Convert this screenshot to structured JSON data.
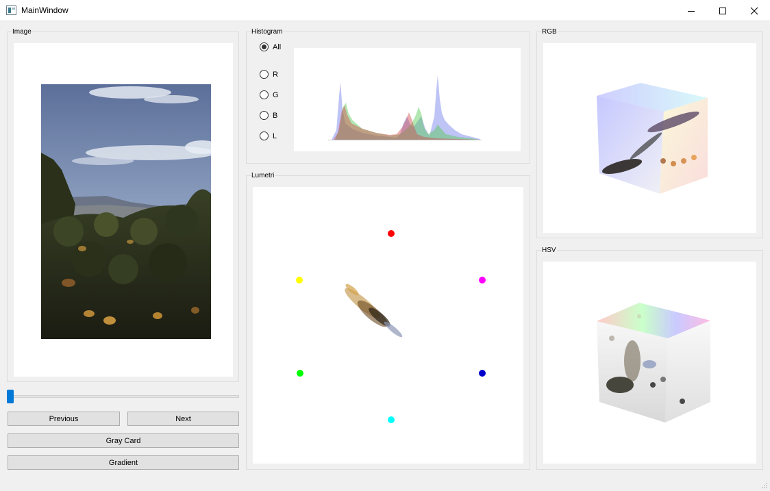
{
  "window": {
    "title": "MainWindow"
  },
  "groups": {
    "image": "Image",
    "histogram": "Histogram",
    "lumetri": "Lumetri",
    "rgb": "RGB",
    "hsv": "HSV"
  },
  "histogram": {
    "channels": [
      {
        "label": "All",
        "checked": true
      },
      {
        "label": "R",
        "checked": false
      },
      {
        "label": "G",
        "checked": false
      },
      {
        "label": "B",
        "checked": false
      },
      {
        "label": "L",
        "checked": false
      }
    ]
  },
  "slider": {
    "value_fraction": 0.0
  },
  "buttons": {
    "previous": "Previous",
    "next": "Next",
    "gray_card": "Gray Card",
    "gradient": "Gradient"
  },
  "lumetri": {
    "targets": [
      {
        "name": "red",
        "color": "#ff0000"
      },
      {
        "name": "magenta",
        "color": "#ff00ff"
      },
      {
        "name": "blue",
        "color": "#0000ff"
      },
      {
        "name": "cyan",
        "color": "#00ffff"
      },
      {
        "name": "green",
        "color": "#00ff00"
      },
      {
        "name": "yellow",
        "color": "#ffff00"
      }
    ]
  },
  "colors": {
    "accent": "#0078d7"
  }
}
